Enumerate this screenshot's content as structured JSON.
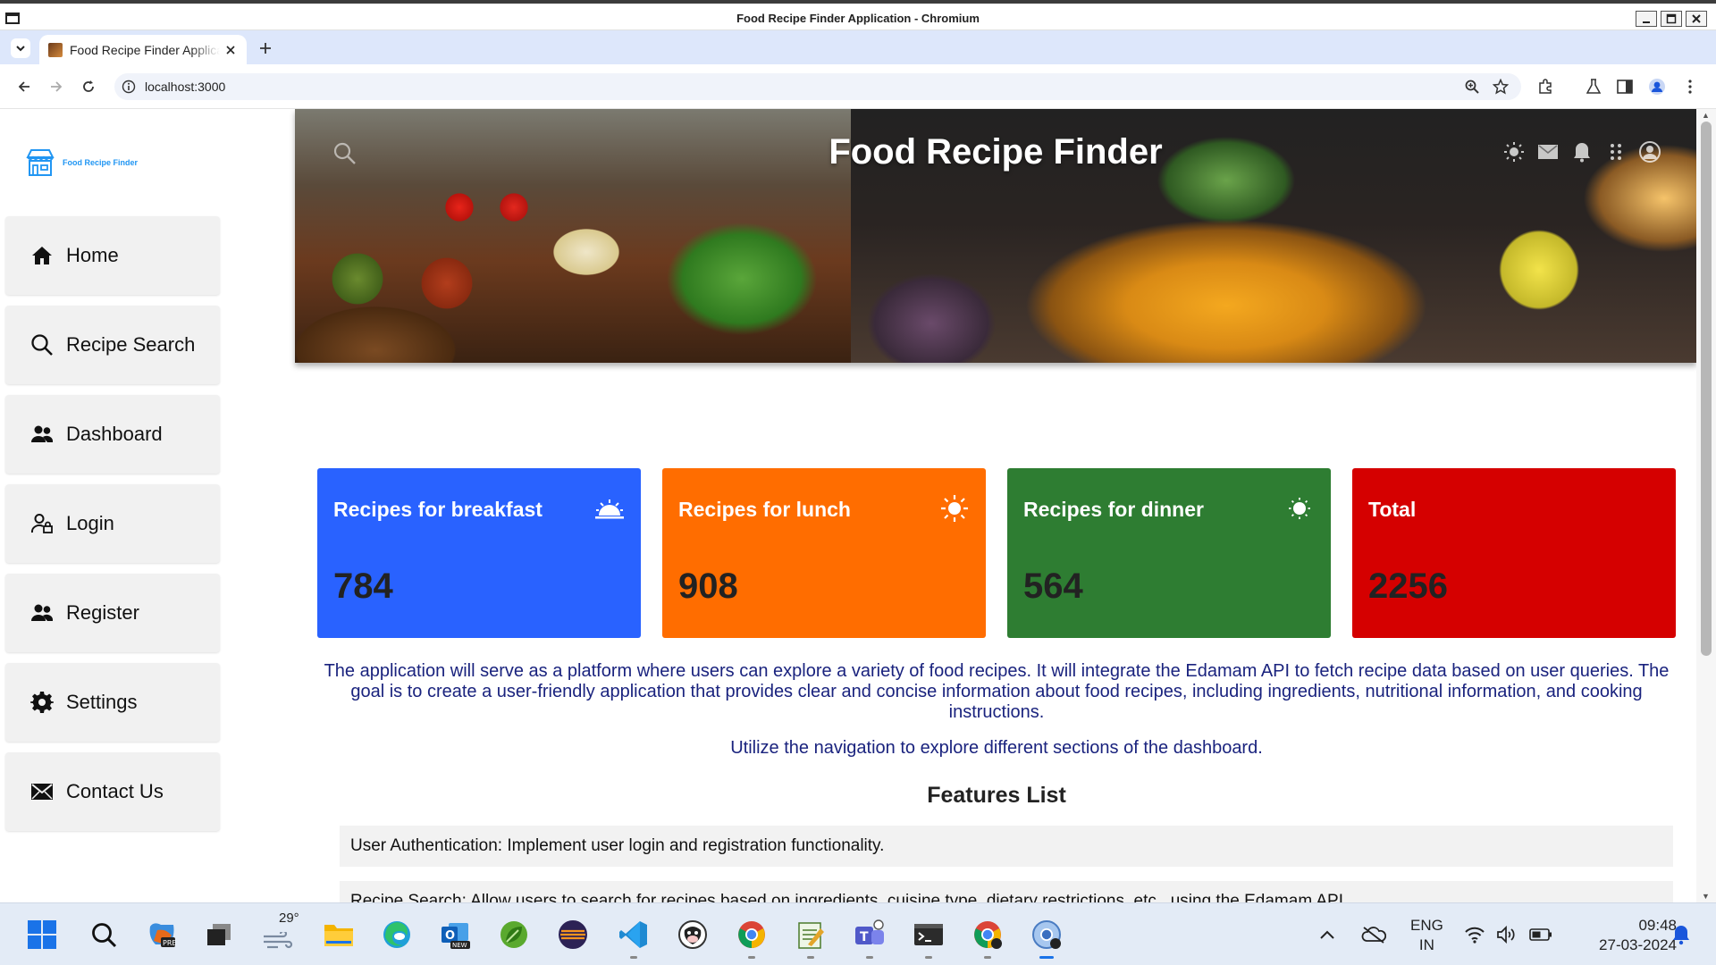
{
  "window": {
    "title": "Food Recipe Finder Application - Chromium"
  },
  "browser": {
    "tab_title": "Food Recipe Finder Application",
    "url": "localhost:3000"
  },
  "sidebar": {
    "brand": "Food Recipe Finder",
    "items": [
      {
        "label": "Home",
        "icon": "home-icon"
      },
      {
        "label": "Recipe Search",
        "icon": "search-icon"
      },
      {
        "label": "Dashboard",
        "icon": "people-icon"
      },
      {
        "label": "Login",
        "icon": "user-lock-icon"
      },
      {
        "label": "Register",
        "icon": "people-icon"
      },
      {
        "label": "Settings",
        "icon": "gear-icon"
      },
      {
        "label": "Contact Us",
        "icon": "mail-icon"
      }
    ]
  },
  "header": {
    "title": "Food Recipe Finder"
  },
  "cards": [
    {
      "title": "Recipes for breakfast",
      "value": "784",
      "color": "#2962ff",
      "icon": "sunrise-icon"
    },
    {
      "title": "Recipes for lunch",
      "value": "908",
      "color": "#ff6d00",
      "icon": "sun-icon"
    },
    {
      "title": "Recipes for dinner",
      "value": "564",
      "color": "#2e7d32",
      "icon": "moon-sun-icon"
    },
    {
      "title": "Total",
      "value": "2256",
      "color": "#d50000",
      "icon": ""
    }
  ],
  "description": "The application will serve as a platform where users can explore a variety of food recipes. It will integrate the Edamam API to fetch recipe data based on user queries. The goal is to create a user-friendly application that provides clear and concise information about food recipes, including ingredients, nutritional information, and cooking instructions.",
  "navigation_hint": "Utilize the navigation to explore different sections of the dashboard.",
  "features": {
    "title": "Features List",
    "items": [
      "User Authentication: Implement user login and registration functionality.",
      "Recipe Search: Allow users to search for recipes based on ingredients, cuisine type, dietary restrictions, etc., using the Edamam API."
    ]
  },
  "taskbar": {
    "weather_temp": "29°",
    "language": "ENG",
    "region": "IN",
    "time": "09:48",
    "date": "27-03-2024"
  }
}
